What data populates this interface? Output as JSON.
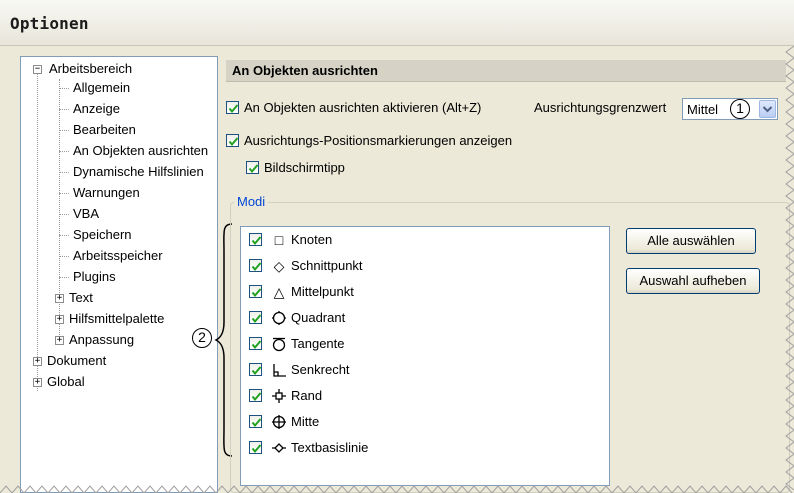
{
  "window": {
    "title": "Optionen"
  },
  "tree": {
    "items": [
      {
        "label": "Arbeitsbereich",
        "expander": "−"
      },
      {
        "label": "Allgemein"
      },
      {
        "label": "Anzeige"
      },
      {
        "label": "Bearbeiten"
      },
      {
        "label": "An Objekten ausrichten"
      },
      {
        "label": "Dynamische Hilfslinien"
      },
      {
        "label": "Warnungen"
      },
      {
        "label": "VBA"
      },
      {
        "label": "Speichern"
      },
      {
        "label": "Arbeitsspeicher"
      },
      {
        "label": "Plugins"
      },
      {
        "label": "Text",
        "expander": "+"
      },
      {
        "label": "Hilfsmittelpalette",
        "expander": "+"
      },
      {
        "label": "Anpassung",
        "expander": "+"
      },
      {
        "label": "Dokument",
        "expander": "+"
      },
      {
        "label": "Global",
        "expander": "+"
      }
    ]
  },
  "panel": {
    "header": "An Objekten ausrichten",
    "enable_snap_label": "An Objekten ausrichten aktivieren (Alt+Z)",
    "threshold_label": "Ausrichtungsgrenzwert",
    "threshold_value": "Mittel",
    "show_markers_label": "Ausrichtungs-Positionsmarkierungen anzeigen",
    "tooltip_label": "Bildschirmtipp",
    "modes_title": "Modi",
    "modes": [
      {
        "label": "Knoten",
        "icon": "square-icon",
        "glyph": "□"
      },
      {
        "label": "Schnittpunkt",
        "icon": "diamond-icon",
        "glyph": "◇"
      },
      {
        "label": "Mittelpunkt",
        "icon": "triangle-icon",
        "glyph": "△"
      },
      {
        "label": "Quadrant",
        "icon": "quadrant-icon",
        "glyph": "◌"
      },
      {
        "label": "Tangente",
        "icon": "tangent-icon",
        "glyph": "◯"
      },
      {
        "label": "Senkrecht",
        "icon": "perpendicular-icon",
        "glyph": "⊥"
      },
      {
        "label": "Rand",
        "icon": "edge-icon",
        "glyph": "⌖"
      },
      {
        "label": "Mitte",
        "icon": "center-icon",
        "glyph": "⊕"
      },
      {
        "label": "Textbasislinie",
        "icon": "text-baseline-icon",
        "glyph": "◇"
      }
    ],
    "select_all_label": "Alle auswählen",
    "deselect_label": "Auswahl aufheben"
  },
  "callouts": {
    "one": "1",
    "two": "2"
  },
  "colors": {
    "check": "#21a121",
    "group_title": "#0046d5",
    "border": "#7f9db9"
  }
}
